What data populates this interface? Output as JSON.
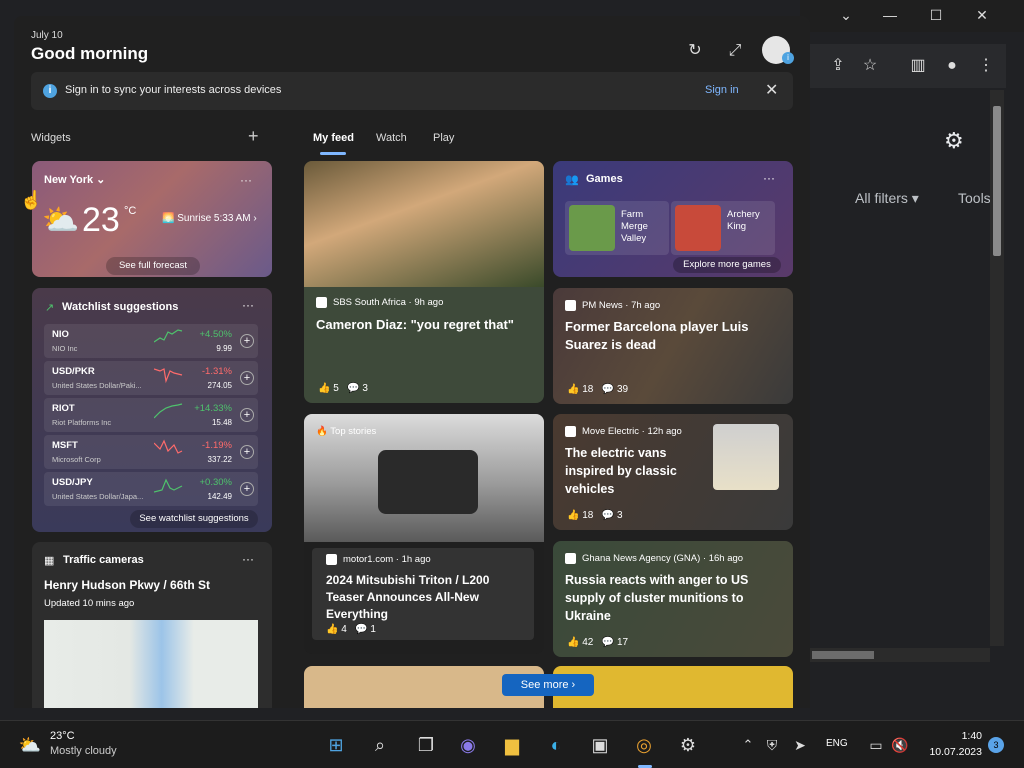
{
  "panel": {
    "date": "July 10",
    "greeting": "Good morning",
    "signin_message": "Sign in to sync your interests across devices",
    "signin_link": "Sign in",
    "widgets_label": "Widgets",
    "tabs": [
      {
        "label": "My feed"
      },
      {
        "label": "Watch"
      },
      {
        "label": "Play"
      }
    ],
    "see_more": "See more"
  },
  "weather": {
    "city": "New York",
    "temp": "23",
    "unit": "°C",
    "sunrise": "Sunrise 5:33 AM",
    "forecast_link": "See full forecast"
  },
  "watchlist": {
    "title": "Watchlist suggestions",
    "link": "See watchlist suggestions",
    "stocks": [
      {
        "symbol": "NIO",
        "name": "NIO Inc",
        "change": "+4.50%",
        "price": "9.99",
        "up": true
      },
      {
        "symbol": "USD/PKR",
        "name": "United States Dollar/Paki...",
        "change": "-1.31%",
        "price": "274.05",
        "up": false
      },
      {
        "symbol": "RIOT",
        "name": "Riot Platforms Inc",
        "change": "+14.33%",
        "price": "15.48",
        "up": true
      },
      {
        "symbol": "MSFT",
        "name": "Microsoft Corp",
        "change": "-1.19%",
        "price": "337.22",
        "up": false
      },
      {
        "symbol": "USD/JPY",
        "name": "United States Dollar/Japa...",
        "change": "+0.30%",
        "price": "142.49",
        "up": true
      }
    ]
  },
  "traffic": {
    "title": "Traffic cameras",
    "road": "Henry Hudson Pkwy / 66th St",
    "updated": "Updated 10 mins ago"
  },
  "games": {
    "title": "Games",
    "items": [
      {
        "name": "Farm Merge Valley"
      },
      {
        "name": "Archery King"
      }
    ],
    "explore": "Explore more games"
  },
  "feed": [
    {
      "source": "SBS South Africa · 9h ago",
      "title": "Cameron Diaz: \"you regret that\"",
      "likes": "5",
      "comments": "3"
    },
    {
      "source": "PM News · 7h ago",
      "title": "Former Barcelona player Luis Suarez is dead",
      "likes": "18",
      "comments": "39"
    },
    {
      "tag": "Top stories",
      "source": "motor1.com · 1h ago",
      "title": "2024 Mitsubishi Triton / L200 Teaser Announces All-New Everything",
      "likes": "4",
      "comments": "1"
    },
    {
      "source": "Move Electric · 12h ago",
      "title": "The electric vans inspired by classic vehicles",
      "likes": "18",
      "comments": "3"
    },
    {
      "source": "Ghana News Agency (GNA) · 16h ago",
      "title": "Russia reacts with anger to US supply of cluster munitions to Ukraine",
      "likes": "42",
      "comments": "17"
    }
  ],
  "chrome": {
    "all_filters": "All filters",
    "tools": "Tools"
  },
  "taskbar": {
    "temp": "23°C",
    "condition": "Mostly cloudy",
    "lang": "ENG",
    "time": "1:40",
    "date": "10.07.2023",
    "notifications": "3"
  },
  "colors": {
    "accent": "#7fb7ff",
    "positive": "#4ec26c",
    "negative": "#ff6b6b",
    "button": "#1565c0"
  }
}
